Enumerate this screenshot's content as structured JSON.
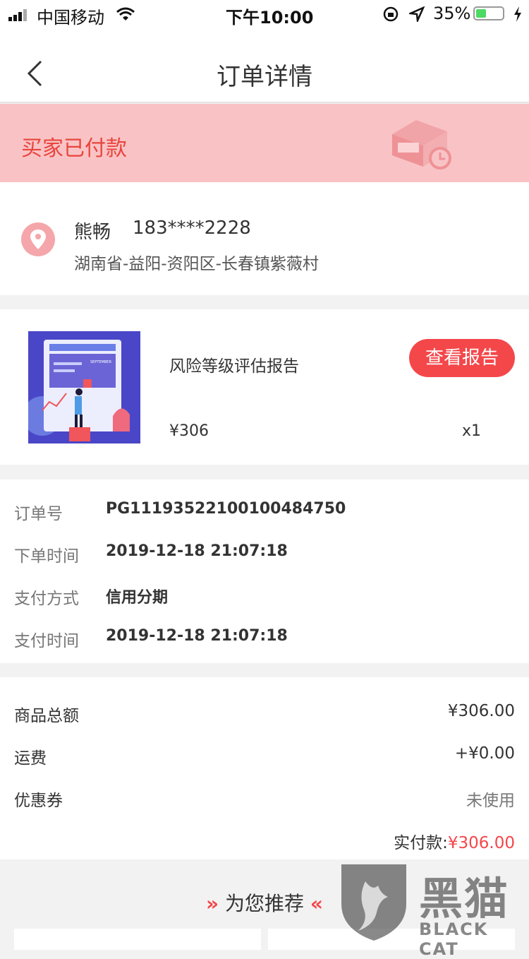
{
  "status_bar": {
    "carrier": "中国移动",
    "time": "下午10:00",
    "battery": "35%"
  },
  "nav": {
    "title": "订单详情",
    "back_icon": "chevron-left-icon"
  },
  "order_status": {
    "text": "买家已付款",
    "icon": "package-clock-icon"
  },
  "address": {
    "name": "熊畅",
    "phone": "183****2228",
    "detail": "湖南省-益阳-资阳区-长春镇紫薇村",
    "icon": "location-pin-icon"
  },
  "product": {
    "title": "风险等级评估报告",
    "price": "¥306",
    "quantity": "x1",
    "button_label": "查看报告",
    "image_text": "SEPTEMBER"
  },
  "order_info": {
    "rows": [
      {
        "label": "订单号",
        "value": "PG11193522100100484750"
      },
      {
        "label": "下单时间",
        "value": "2019-12-18 21:07:18"
      },
      {
        "label": "支付方式",
        "value": "信用分期"
      },
      {
        "label": "支付时间",
        "value": "2019-12-18 21:07:18"
      }
    ]
  },
  "amounts": {
    "rows": [
      {
        "label": "商品总额",
        "value": "¥306.00"
      },
      {
        "label": "运费",
        "value": "+¥0.00"
      },
      {
        "label": "优惠券",
        "value": "未使用"
      }
    ],
    "paid_label": "实付款:",
    "paid_value": "¥306.00"
  },
  "recommend": {
    "title": "为您推荐",
    "left_icon": "double-chevron-right-icon",
    "right_icon": "double-chevron-left-icon"
  },
  "watermark": {
    "cn": "黑猫",
    "en": "BLACK CAT"
  },
  "colors": {
    "accent": "#f4474a",
    "banner_bg": "#f9c3c6",
    "banner_text": "#e8453c"
  }
}
